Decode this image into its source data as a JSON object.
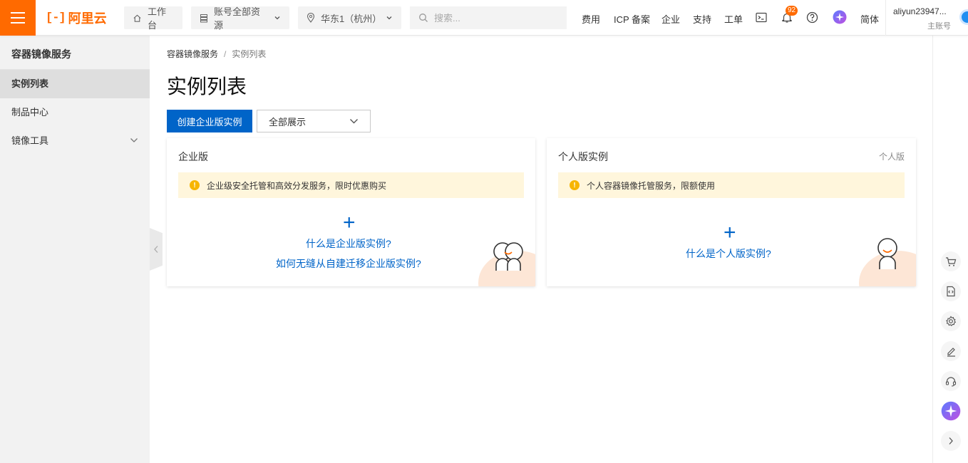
{
  "topbar": {
    "logo_text": "阿里云",
    "workbench": "工作台",
    "resources": "账号全部资源",
    "region": "华东1（杭州）",
    "search_placeholder": "搜索...",
    "links": [
      "费用",
      "ICP 备案",
      "企业",
      "支持",
      "工单"
    ],
    "notification_count": "92",
    "language": "简体",
    "account_name": "aliyun23947...",
    "account_role": "主账号"
  },
  "sidebar": {
    "title": "容器镜像服务",
    "items": [
      {
        "label": "实例列表",
        "active": true
      },
      {
        "label": "制品中心"
      },
      {
        "label": "镜像工具",
        "expandable": true
      }
    ]
  },
  "breadcrumb": {
    "root": "容器镜像服务",
    "separator": "/",
    "current": "实例列表"
  },
  "page": {
    "title": "实例列表",
    "create_button": "创建企业版实例",
    "filter_selected": "全部展示"
  },
  "cards": {
    "enterprise": {
      "title": "企业版",
      "notice": "企业级安全托管和高效分发服务，限时优惠购买",
      "plus": "+",
      "link1": "什么是企业版实例?",
      "link2": "如何无缝从自建迁移企业版实例?"
    },
    "personal": {
      "title": "个人版实例",
      "tag": "个人版",
      "notice": "个人容器镜像托管服务，限额使用",
      "plus": "+",
      "link1": "什么是个人版实例?"
    }
  },
  "colors": {
    "brand": "#ff6a00",
    "primary": "#0064c8",
    "notice_bg": "#fff6dc",
    "warning": "#f7b500"
  },
  "right_rail": [
    "cart-icon",
    "code-doc-icon",
    "gear-icon",
    "edit-icon",
    "headset-icon",
    "ai-assistant-icon",
    "chevron-right-icon"
  ]
}
